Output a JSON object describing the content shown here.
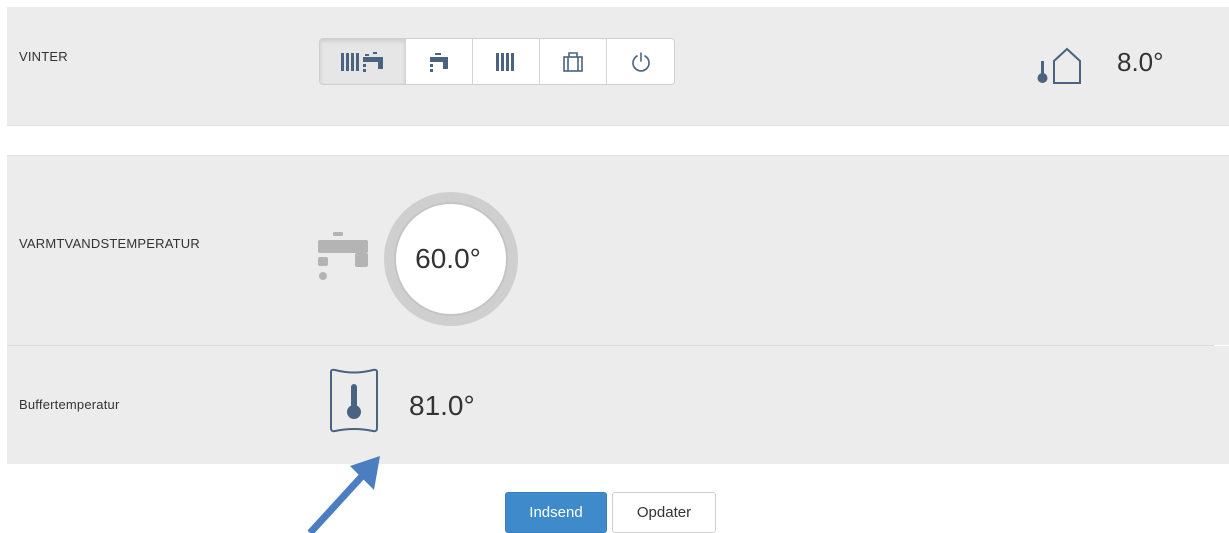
{
  "mode_row": {
    "label": "VINTER",
    "modes": [
      {
        "icon": "radiator-tap-icon",
        "active": true
      },
      {
        "icon": "tap-icon",
        "active": false
      },
      {
        "icon": "radiator-icon",
        "active": false
      },
      {
        "icon": "suitcase-icon",
        "active": false
      },
      {
        "icon": "power-icon",
        "active": false
      }
    ],
    "outdoor_temp": "8.0°"
  },
  "water_row": {
    "label": "VARMTVANDSTEMPERATUR",
    "temp": "60.0°"
  },
  "buffer_row": {
    "label": "Buffertemperatur",
    "temp": "81.0°"
  },
  "actions": {
    "submit_label": "Indsend",
    "update_label": "Opdater"
  },
  "colors": {
    "icon": "#4a6380",
    "accent": "#3f8acb",
    "panel": "#ececec",
    "arrow": "#4a7ec0"
  }
}
